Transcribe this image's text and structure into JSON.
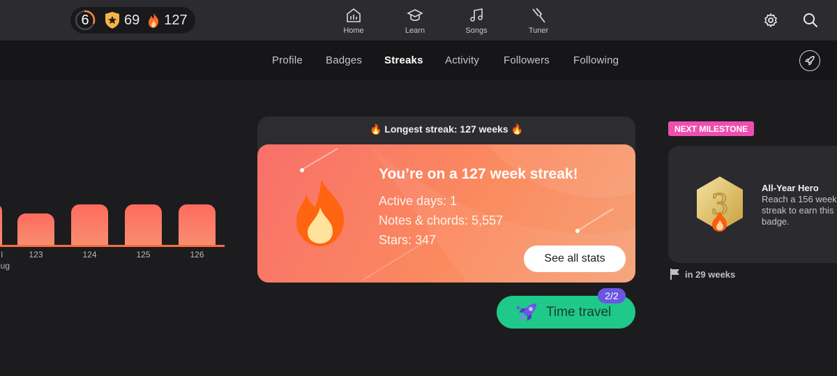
{
  "topbar": {
    "level": "6",
    "level_progress": 0.3,
    "badges_count": "69",
    "streak_count": "127",
    "nav": [
      {
        "label": "Home",
        "icon": "home-icon"
      },
      {
        "label": "Learn",
        "icon": "graduation-cap-icon"
      },
      {
        "label": "Songs",
        "icon": "music-note-icon"
      },
      {
        "label": "Tuner",
        "icon": "tuning-fork-icon"
      }
    ],
    "settings_icon": "gear-icon",
    "search_icon": "search-icon"
  },
  "tabs": [
    {
      "label": "Profile",
      "active": false
    },
    {
      "label": "Badges",
      "active": false
    },
    {
      "label": "Streaks",
      "active": true
    },
    {
      "label": "Activity",
      "active": false
    },
    {
      "label": "Followers",
      "active": false
    },
    {
      "label": "Following",
      "active": false
    }
  ],
  "share_icon": "rocket-share-icon",
  "chart_data": {
    "type": "bar",
    "categories": [
      "123",
      "124",
      "125",
      "126"
    ],
    "values": [
      42,
      54,
      54,
      54
    ],
    "partial_labels": [
      "l",
      "ug"
    ]
  },
  "streak_card": {
    "header": "Longest streak: 127 weeks",
    "title": "You’re on a 127 week streak!",
    "active_days": "Active days: 1",
    "notes_chords": "Notes & chords: 5,557",
    "stars": "Stars: 347",
    "see_all_label": "See all stats"
  },
  "time_travel": {
    "label": "Time travel",
    "count": "2/2"
  },
  "milestone": {
    "tag": "NEXT MILESTONE",
    "title": "All-Year Hero",
    "description": "Reach a 156 week streak to earn this badge.",
    "badge_number": "3",
    "eta": "in 29 weeks"
  },
  "colors": {
    "accent_orange": "#ff6c3e",
    "streak_card": "#f8706a",
    "time_travel_green": "#1ec989",
    "milestone_pink": "#ee4fae",
    "badge_purple": "#6a56e3"
  }
}
